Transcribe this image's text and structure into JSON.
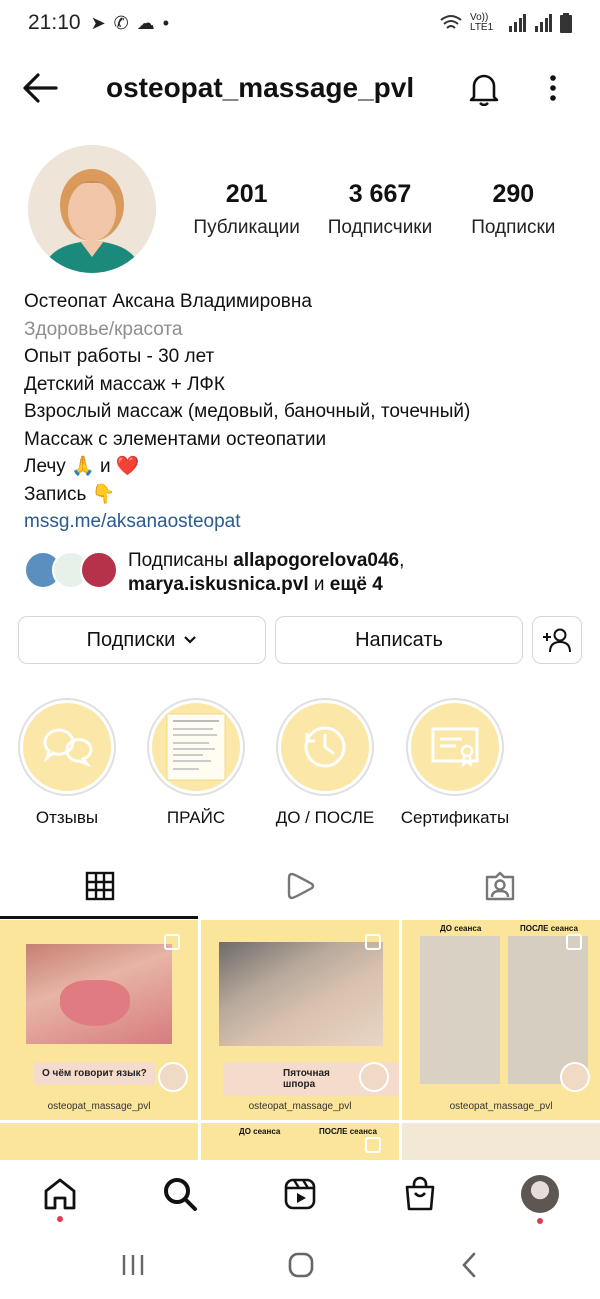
{
  "status": {
    "time": "21:10",
    "network": "Vo)) LTE1"
  },
  "header": {
    "username": "osteopat_massage_pvl"
  },
  "stats": [
    {
      "value": "201",
      "label": "Публикации"
    },
    {
      "value": "3 667",
      "label": "Подписчики"
    },
    {
      "value": "290",
      "label": "Подписки"
    }
  ],
  "bio": {
    "name": "Остеопат Аксана Владимировна",
    "category": "Здоровье/красота",
    "line1": "Опыт работы - 30 лет",
    "line2": "Детский массаж + ЛФК",
    "line3": "Взрослый массаж (медовый, баночный, точечный)",
    "line4": "Массаж с элементами остеопатии",
    "line5": "Лечу 🙏 и ❤️",
    "line6": "Запись 👇",
    "link": "mssg.me/aksanaosteopat"
  },
  "followed_by": {
    "prefix": "Подписаны",
    "user1": "allapogorelova046",
    "sep": ",",
    "user2": "marya.iskusnica.pvl",
    "and": "и",
    "more": "ещё 4"
  },
  "buttons": {
    "following": "Подписки",
    "message": "Написать"
  },
  "highlights": [
    {
      "label": "Отзывы",
      "icon": "chat-bubbles-icon"
    },
    {
      "label": "ПРАЙС",
      "icon": "price-list-icon"
    },
    {
      "label": "ДО / ПОСЛЕ",
      "icon": "clock-icon"
    },
    {
      "label": "Сертификаты",
      "icon": "certificate-icon"
    }
  ],
  "posts": {
    "caption": "osteopat_massage_pvl",
    "post1_title": "О чём говорит язык?",
    "post2_title": "Пяточная шпора",
    "before": "ДО сеанса",
    "after": "ПОСЛЕ сеанса"
  },
  "colors": {
    "highlight_bg": "#fbe7a7",
    "post_bg": "#fbe59a",
    "link": "#2a5a8f",
    "notification_dot": "#e53950"
  }
}
